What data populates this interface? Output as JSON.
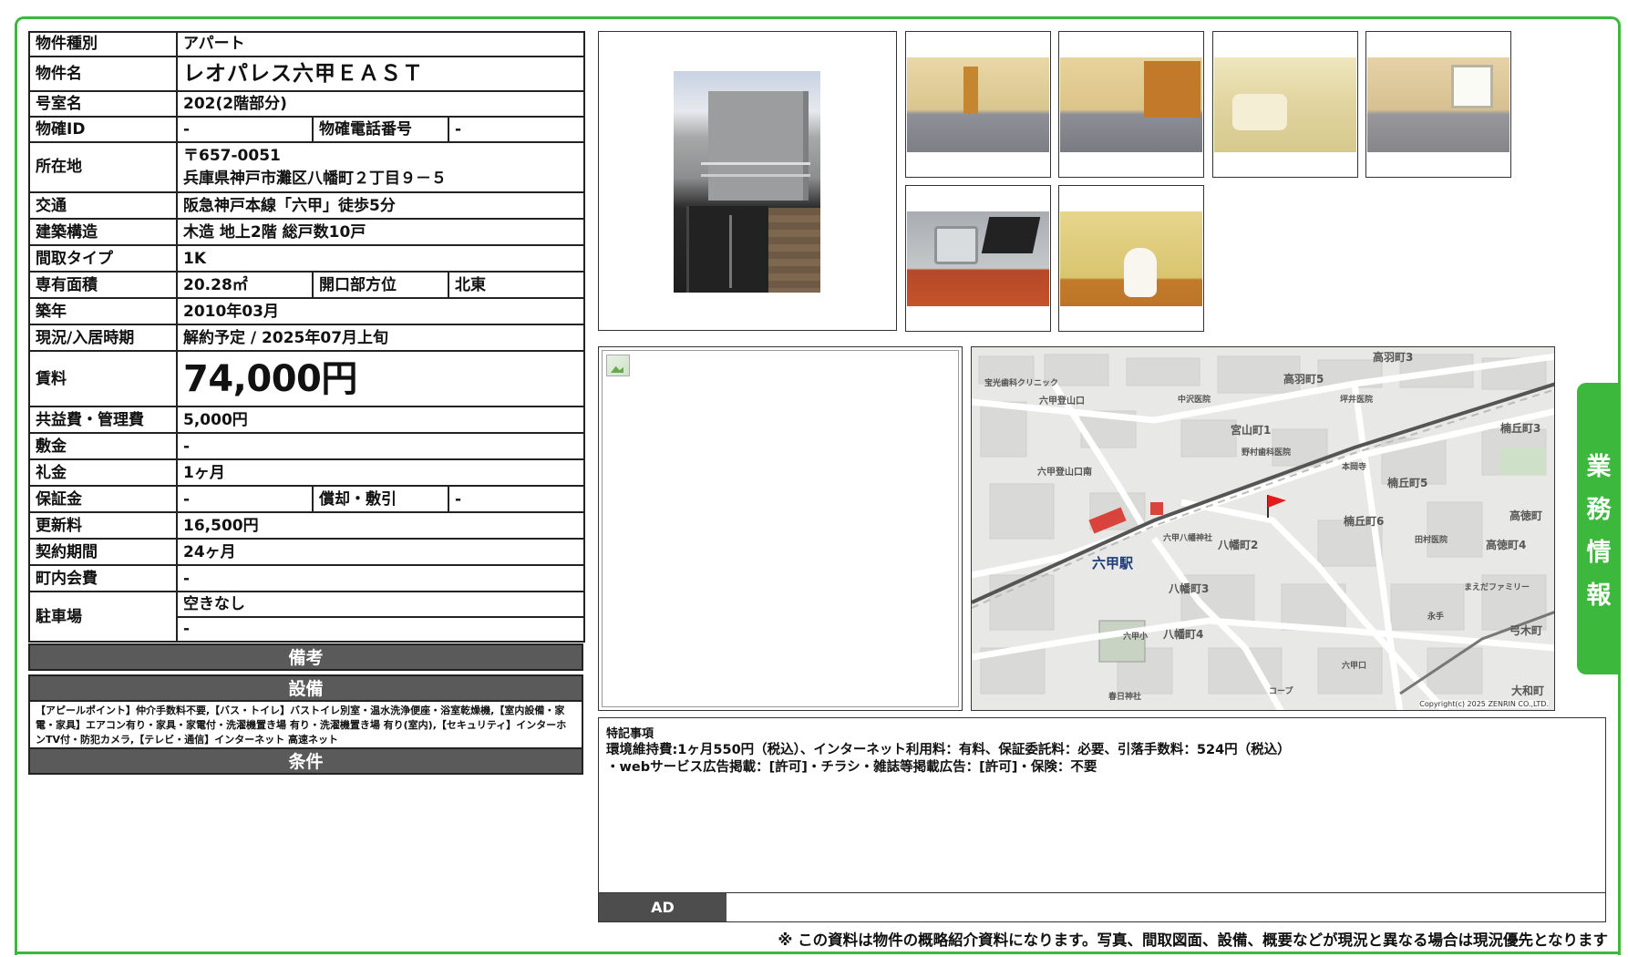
{
  "property": {
    "type_label": "物件種別",
    "type_value": "アパート",
    "name_label": "物件名",
    "name_value": "レオパレス六甲ＥＡＳＴ",
    "room_label": "号室名",
    "room_value": "202(2階部分)",
    "id_label": "物確ID",
    "id_value": "-",
    "phone_label": "物確電話番号",
    "phone_value": "-",
    "address_label": "所在地",
    "address_zip": "〒657-0051",
    "address_value": "兵庫県神戸市灘区八幡町２丁目９－５",
    "transport_label": "交通",
    "transport_value": "阪急神戸本線「六甲」徒歩5分",
    "structure_label": "建築構造",
    "structure_value": "木造 地上2階 総戸数10戸",
    "layout_label": "間取タイプ",
    "layout_value": "1K",
    "area_label": "専有面積",
    "area_value": "20.28㎡",
    "direction_label": "開口部方位",
    "direction_value": "北東",
    "built_label": "築年",
    "built_value": "2010年03月",
    "status_label": "現況/入居時期",
    "status_value": "解約予定 / 2025年07月上旬",
    "rent_label": "賃料",
    "rent_value": "74,000円",
    "fee_label": "共益費・管理費",
    "fee_value": "5,000円",
    "deposit_label": "敷金",
    "deposit_value": "-",
    "key_money_label": "礼金",
    "key_money_value": "1ヶ月",
    "guarantee_label": "保証金",
    "guarantee_value": "-",
    "amortization_label": "償却・敷引",
    "amortization_value": "-",
    "renewal_label": "更新料",
    "renewal_value": "16,500円",
    "contract_label": "契約期間",
    "contract_value": "24ヶ月",
    "community_label": "町内会費",
    "community_value": "-",
    "parking_label": "駐車場",
    "parking_value": "空きなし",
    "parking_sub": "-"
  },
  "sections": {
    "remarks": "備考",
    "facilities": "設備",
    "facilities_text": "【アピールポイント】仲介手数料不要,【バス・トイレ】バストイレ別室・温水洗浄便座・浴室乾燥機,【室内設備・家電・家具】エアコン有り・家具・家電付・洗濯機置き場 有り・洗濯機置き場 有り(室内),【セキュリティ】インターホンTV付・防犯カメラ,【テレビ・通信】インターネット 高速ネット",
    "conditions": "条件"
  },
  "map": {
    "station": "六甲駅",
    "labels": [
      "高羽町5",
      "宮山町1",
      "楠丘町3",
      "楠丘町5",
      "楠丘町6",
      "八幡町2",
      "八幡町3",
      "八幡町4",
      "高徳町4",
      "弓木町",
      "大和町",
      "六甲登山口",
      "六甲登山口南",
      "六甲八幡神社",
      "中沢医院",
      "野村歯科医院",
      "六甲口",
      "永手",
      "コープ",
      "春日神社",
      "六甲小",
      "宝光歯科クリニック",
      "坪井医院",
      "本岡寺",
      "田村医院",
      "まえだファミリー",
      "高羽町3",
      "高徳町"
    ],
    "copyright": "Copyright(c) 2025 ZENRIN CO.,LTD."
  },
  "side_tab": [
    "業",
    "務",
    "情",
    "報"
  ],
  "notes": {
    "title": "特記事項",
    "line1": "環境維持費:1ヶ月550円（税込）、インターネット利用料：有料、保証委託料：必要、引落手数料：524円（税込）",
    "line2": "・webサービス広告掲載：[許可]・チラシ・雑誌等掲載広告：[許可]・保険：不要"
  },
  "ad": {
    "label": "AD",
    "value": ""
  },
  "disclaimer": "※ この資料は物件の概略紹介資料になります。写真、間取図面、設備、概要などが現況と異なる場合は現況優先となります",
  "colors": {
    "accent": "#3cb83c",
    "bar": "#5a5a5a"
  }
}
